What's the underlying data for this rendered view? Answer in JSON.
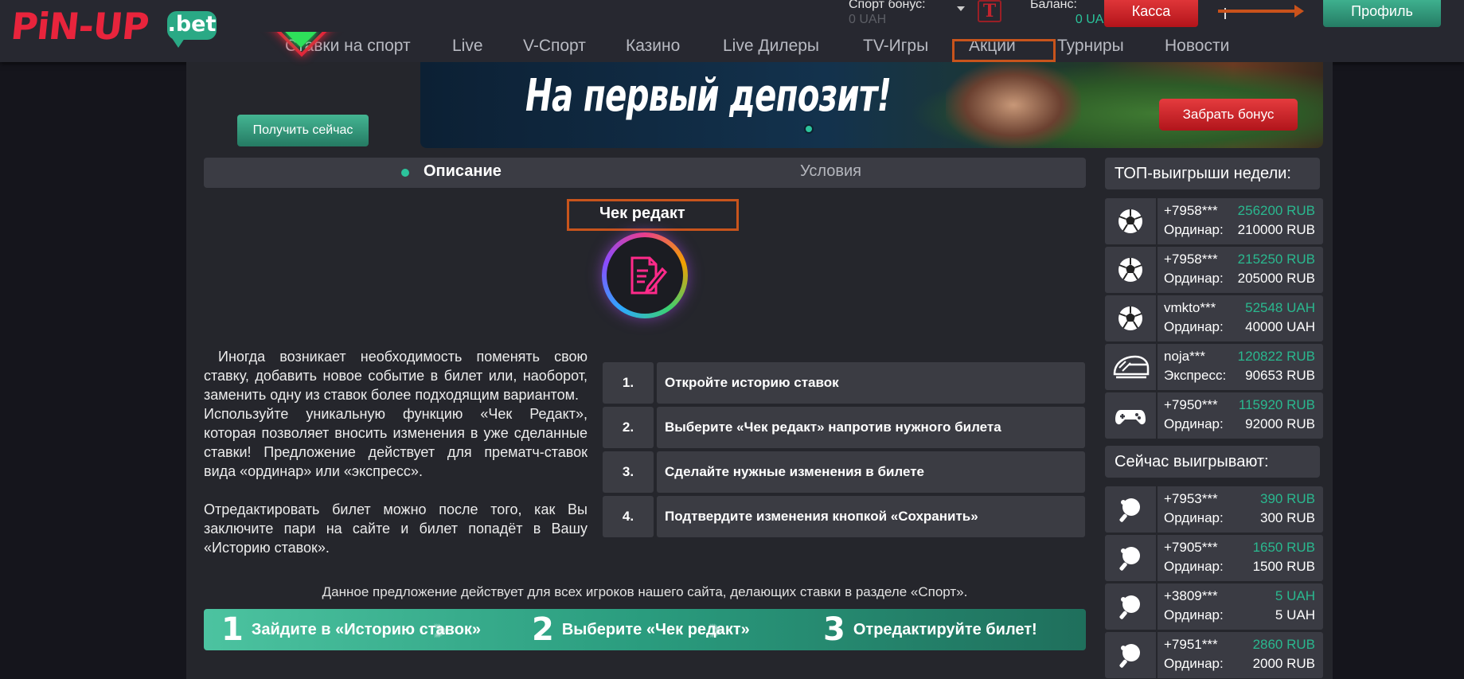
{
  "header": {
    "logo_text": "PiN-UP",
    "logo_suffix": ".bet",
    "sport_bonus_label": "Спорт бонус:",
    "sport_bonus_value": "0 UAH",
    "balance_label": "Баланс:",
    "balance_value": "0 UAH",
    "kassa_label": "Касса",
    "profile_label": "Профиль"
  },
  "nav": {
    "items": [
      "Ставки на спорт",
      "Live",
      "V-Спорт",
      "Казино",
      "Live Дилеры",
      "TV-Игры",
      "Акции",
      "Турниры",
      "Новости"
    ]
  },
  "promo": {
    "get_now_label": "Получить сейчас",
    "banner_text": "На первый депозит!",
    "bonus_button_label": "Забрать бонус"
  },
  "tabs": {
    "description": "Описание",
    "conditions": "Условия"
  },
  "article": {
    "title": "Чек редакт",
    "paragraph1": "Иногда возникает необходимость поменять свою ставку, добавить новое событие в билет или, наоборот, заменить одну из ставок более подходящим вариантом.",
    "paragraph2": "Используйте уникальную функцию «Чек Редакт», которая позволяет вносить изменения в уже сделанные ставки! Предложение действует для прематч-ставок вида «ординар» или «экспресс».",
    "paragraph3": "Отредактировать билет можно после того, как Вы заключите пари на сайте и билет попадёт в Вашу «Историю ставок».",
    "steps": [
      {
        "num": "1.",
        "text": "Откройте историю ставок"
      },
      {
        "num": "2.",
        "text": "Выберите «Чек редакт» напротив нужного билета"
      },
      {
        "num": "3.",
        "text": "Сделайте нужные изменения в билете"
      },
      {
        "num": "4.",
        "text": "Подтвердите изменения кнопкой «Сохранить»"
      }
    ],
    "offer_text": "Данное предложение действует для всех игроков нашего сайта, делающих ставки в разделе «Спорт».",
    "howto": [
      {
        "num": "1",
        "text": "Зайдите в «Историю ставок»"
      },
      {
        "num": "2",
        "text": "Выберите «Чек редакт»"
      },
      {
        "num": "3",
        "text": "Отредактируйте билет!"
      }
    ]
  },
  "sidebar": {
    "top_title": "ТОП-выигрыши недели:",
    "top_wins": [
      {
        "icon": "soccer-ball-icon",
        "user": "+7958***",
        "amount": "256200 RUB",
        "type": "Ординар:",
        "stake": "210000 RUB"
      },
      {
        "icon": "soccer-ball-icon",
        "user": "+7958***",
        "amount": "215250 RUB",
        "type": "Ординар:",
        "stake": "205000 RUB"
      },
      {
        "icon": "soccer-ball-icon",
        "user": "vmkto***",
        "amount": "52548 UAH",
        "type": "Ординар:",
        "stake": "40000 UAH"
      },
      {
        "icon": "racing-helmet-icon",
        "user": "noja***",
        "amount": "120822 RUB",
        "type": "Экспресс:",
        "stake": "90653 RUB"
      },
      {
        "icon": "gamepad-icon",
        "user": "+7950***",
        "amount": "115920 RUB",
        "type": "Ординар:",
        "stake": "92000 RUB"
      }
    ],
    "now_title": "Сейчас выигрывают:",
    "now_wins": [
      {
        "icon": "table-tennis-icon",
        "user": "+7953***",
        "amount": "390 RUB",
        "type": "Ординар:",
        "stake": "300 RUB"
      },
      {
        "icon": "table-tennis-icon",
        "user": "+7905***",
        "amount": "1650 RUB",
        "type": "Ординар:",
        "stake": "1500 RUB"
      },
      {
        "icon": "table-tennis-icon",
        "user": "+3809***",
        "amount": "5 UAH",
        "type": "Ординар:",
        "stake": "5 UAH"
      },
      {
        "icon": "table-tennis-icon",
        "user": "+7951***",
        "amount": "2860 RUB",
        "type": "Ординар:",
        "stake": "2000 RUB"
      }
    ]
  }
}
